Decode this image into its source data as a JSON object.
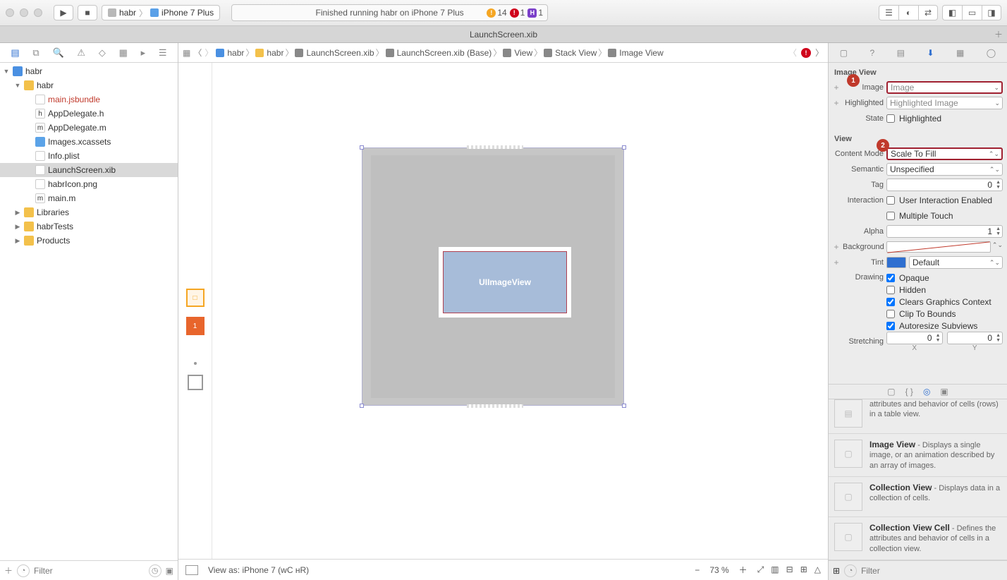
{
  "toolbar": {
    "scheme_target": "habr",
    "scheme_device": "iPhone 7 Plus",
    "activity": "Finished running habr on iPhone 7 Plus",
    "warn_count": "14",
    "err_count": "1",
    "h_count": "1"
  },
  "tab": {
    "title": "LaunchScreen.xib"
  },
  "navigator": {
    "filter_placeholder": "Filter",
    "tree": [
      {
        "d": 0,
        "icon": "proj",
        "tri": "▼",
        "label": "habr"
      },
      {
        "d": 1,
        "icon": "folder",
        "tri": "▼",
        "label": "habr"
      },
      {
        "d": 2,
        "icon": "file",
        "label": "main.jsbundle",
        "red": true
      },
      {
        "d": 2,
        "icon": "file",
        "label": "AppDelegate.h",
        "pre": "h"
      },
      {
        "d": 2,
        "icon": "file",
        "label": "AppDelegate.m",
        "pre": "m"
      },
      {
        "d": 2,
        "icon": "folder2",
        "label": "Images.xcassets"
      },
      {
        "d": 2,
        "icon": "file",
        "label": "Info.plist"
      },
      {
        "d": 2,
        "icon": "file",
        "label": "LaunchScreen.xib",
        "sel": true
      },
      {
        "d": 2,
        "icon": "file",
        "label": "habrIcon.png"
      },
      {
        "d": 2,
        "icon": "file",
        "label": "main.m",
        "pre": "m"
      },
      {
        "d": 1,
        "icon": "folder",
        "tri": "▶",
        "label": "Libraries"
      },
      {
        "d": 1,
        "icon": "folder",
        "tri": "▶",
        "label": "habrTests"
      },
      {
        "d": 1,
        "icon": "folder",
        "tri": "▶",
        "label": "Products"
      }
    ]
  },
  "jumpbar": {
    "items": [
      "habr",
      "habr",
      "LaunchScreen.xib",
      "LaunchScreen.xib (Base)",
      "View",
      "Stack View",
      "Image View"
    ]
  },
  "canvas": {
    "imgview_label": "UIImageView"
  },
  "editor_bottom": {
    "viewas": "View as: iPhone 7 (ᴡC ʜR)",
    "zoom": "73 %"
  },
  "inspector": {
    "sections": {
      "imageview": "Image View",
      "view": "View"
    },
    "image_label": "Image",
    "image_placeholder": "Image",
    "highlighted_label": "Highlighted",
    "highlighted_placeholder": "Highlighted Image",
    "state_label": "State",
    "state_check": "Highlighted",
    "content_mode_label": "Content Mode",
    "content_mode_value": "Scale To Fill",
    "semantic_label": "Semantic",
    "semantic_value": "Unspecified",
    "tag_label": "Tag",
    "tag_value": "0",
    "interaction_label": "Interaction",
    "interaction_items": [
      "User Interaction Enabled",
      "Multiple Touch"
    ],
    "alpha_label": "Alpha",
    "alpha_value": "1",
    "background_label": "Background",
    "tint_label": "Tint",
    "tint_value": "Default",
    "drawing_label": "Drawing",
    "drawing_items": [
      {
        "label": "Opaque",
        "ck": true
      },
      {
        "label": "Hidden",
        "ck": false
      },
      {
        "label": "Clears Graphics Context",
        "ck": true
      },
      {
        "label": "Clip To Bounds",
        "ck": false
      },
      {
        "label": "Autoresize Subviews",
        "ck": true
      }
    ],
    "stretching_label": "Stretching",
    "stretch_x": "0",
    "stretch_x_lbl": "X",
    "stretch_y": "0",
    "stretch_y_lbl": "Y"
  },
  "library": {
    "partial": "attributes and behavior of cells (rows) in a table view.",
    "items": [
      {
        "title": "Image View",
        "desc": " - Displays a single image, or an animation described by an array of images."
      },
      {
        "title": "Collection View",
        "desc": " - Displays data in a collection of cells."
      },
      {
        "title": "Collection View Cell",
        "desc": " - Defines the attributes and behavior of cells in a collection view."
      }
    ],
    "filter_placeholder": "Filter"
  },
  "annotations": {
    "a1": "1",
    "a2": "2"
  }
}
